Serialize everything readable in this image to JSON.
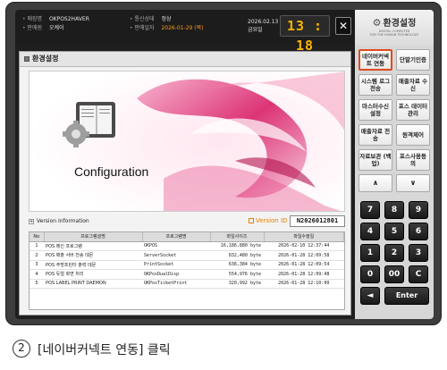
{
  "header": {
    "store_label": "매장명",
    "store_value": "OKPOS2HAVER",
    "staff_label": "판매원",
    "staff_value": "오케이",
    "comm_label": "통신상태",
    "comm_value": "정상",
    "sales_label": "판매일자",
    "sales_value": "2026-01-29 (목)",
    "date": "2026.02.13",
    "weekday": "금요일",
    "clock": "13 : 18",
    "close_label": "✕"
  },
  "panel": {
    "title": "환경설정",
    "config_title": "Configuration",
    "version_info_label": "Version Information",
    "version_label": "Version ID :",
    "version_value": "N2026012801"
  },
  "table": {
    "headers": [
      "No",
      "프로그램설명",
      "프로그램명",
      "파일사이즈",
      "파일수정일"
    ],
    "rows": [
      [
        "1",
        "POS 메인 프로그램",
        "OKPOS",
        "16,186,880 byte",
        "2026-02-10 12:37:44"
      ],
      [
        "2",
        "POS 매출 서버 전송 데몬",
        "ServerSocket",
        "832,480 byte",
        "2026-01-28 12:09:58"
      ],
      [
        "3",
        "POS 주방프린터 출력 데몬",
        "PrintSocket",
        "636,384 byte",
        "2026-01-28 12:09:54"
      ],
      [
        "4",
        "POS 듀얼 화면 처리",
        "OKPosDualDisp",
        "554,976 byte",
        "2026-01-28 12:09:48"
      ],
      [
        "5",
        "POS LABEL PRINT DAEMON",
        "OKPosTicketPrint",
        "320,992 byte",
        "2026-01-28 12:10:00"
      ]
    ]
  },
  "side": {
    "title": "환경설정",
    "subtitle1": "DIGITAL COMPUTER",
    "subtitle2": "FOR THE HUMAN TECHNOLOGY",
    "buttons": [
      "네이버커넥트 연동",
      "단말기인증",
      "시스템 로그전송",
      "매출자료 수신",
      "마스터수신 설정",
      "포스 데이터관리",
      "매출자료 전송",
      "원격제어",
      "자료보관 (백업)",
      "포스사용등 의",
      "∧",
      "∨"
    ]
  },
  "numpad": {
    "keys": [
      "7",
      "8",
      "9",
      "4",
      "5",
      "6",
      "1",
      "2",
      "3",
      "0",
      "00",
      "C",
      "◄",
      "Enter"
    ]
  },
  "caption": {
    "number": "2",
    "text": "[네이버커넥트 연동] 클릭"
  },
  "colors": {
    "highlight": "#e04a1f",
    "clock": "#ffb400",
    "sales_date": "#ff9a1a"
  }
}
